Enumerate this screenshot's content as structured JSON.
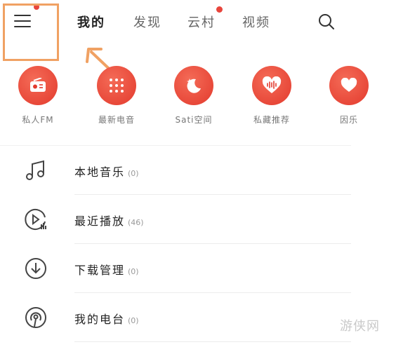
{
  "nav": {
    "tabs": [
      {
        "label": "我的",
        "active": true
      },
      {
        "label": "发现",
        "active": false
      },
      {
        "label": "云村",
        "active": false,
        "badge": true
      },
      {
        "label": "视频",
        "active": false
      }
    ],
    "menu_icon": "hamburger-menu-icon",
    "search_icon": "search-icon"
  },
  "features": [
    {
      "label": "私人FM",
      "icon": "radio-icon"
    },
    {
      "label": "最新电音",
      "icon": "dots-grid-icon"
    },
    {
      "label": "Sati空间",
      "icon": "moon-star-icon"
    },
    {
      "label": "私藏推荐",
      "icon": "heart-wave-icon"
    },
    {
      "label": "因乐",
      "icon": "heart-icon"
    }
  ],
  "list": [
    {
      "title": "本地音乐",
      "count": "(0)",
      "icon": "music-note-icon"
    },
    {
      "title": "最近播放",
      "count": "(46)",
      "icon": "recent-play-icon"
    },
    {
      "title": "下载管理",
      "count": "(0)",
      "icon": "download-icon"
    },
    {
      "title": "我的电台",
      "count": "(0)",
      "icon": "podcast-icon"
    }
  ],
  "watermark": "游侠网",
  "colors": {
    "accent": "#e33a2d",
    "highlight": "#f0a163"
  }
}
